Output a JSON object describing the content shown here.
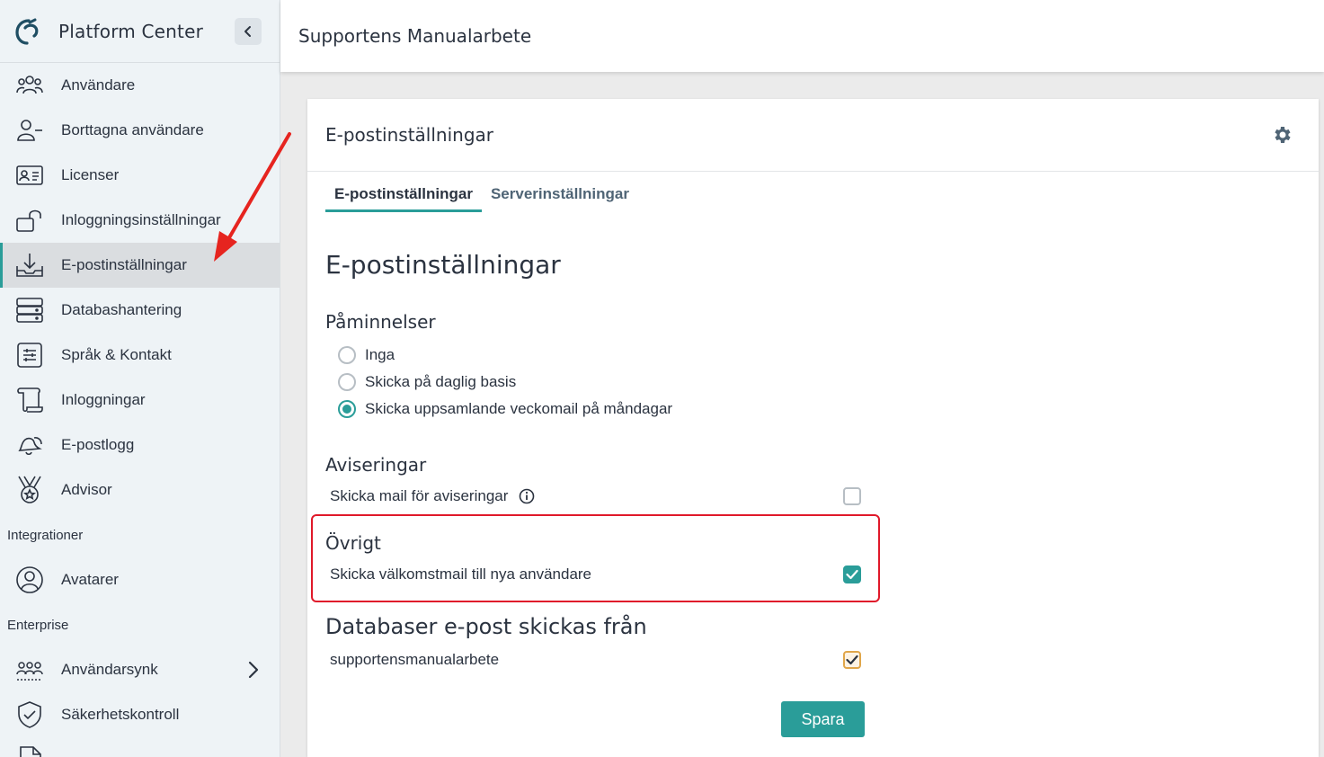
{
  "brand": {
    "name": "Platform Center"
  },
  "sidebar": {
    "items": [
      {
        "label": "Användare",
        "icon": "users-icon"
      },
      {
        "label": "Borttagna användare",
        "icon": "user-remove-icon"
      },
      {
        "label": "Licenser",
        "icon": "id-card-icon"
      },
      {
        "label": "Inloggningsinställningar",
        "icon": "unlock-icon"
      },
      {
        "label": "E-postinställningar",
        "icon": "inbox-download-icon",
        "active": true
      },
      {
        "label": "Databashantering",
        "icon": "server-icon"
      },
      {
        "label": "Språk & Kontakt",
        "icon": "sliders-icon"
      },
      {
        "label": "Inloggningar",
        "icon": "scroll-icon"
      },
      {
        "label": "E-postlogg",
        "icon": "bells-icon"
      },
      {
        "label": "Advisor",
        "icon": "medal-icon"
      }
    ],
    "sections": [
      {
        "title": "Integrationer",
        "items": [
          {
            "label": "Avatarer",
            "icon": "user-circle-icon"
          }
        ]
      },
      {
        "title": "Enterprise",
        "items": [
          {
            "label": "Användarsynk",
            "icon": "users-sync-icon"
          },
          {
            "label": "Säkerhetskontroll",
            "icon": "shield-check-icon"
          }
        ]
      }
    ]
  },
  "header": {
    "title": "Supportens Manualarbete"
  },
  "card": {
    "title": "E-postinställningar",
    "tabs": [
      {
        "label": "E-postinställningar",
        "active": true
      },
      {
        "label": "Serverinställningar"
      }
    ],
    "heading": "E-postinställningar",
    "reminders": {
      "title": "Påminnelser",
      "options": [
        {
          "label": "Inga",
          "checked": false
        },
        {
          "label": "Skicka på daglig basis",
          "checked": false
        },
        {
          "label": "Skicka uppsamlande veckomail på måndagar",
          "checked": true
        }
      ]
    },
    "notifications": {
      "title": "Aviseringar",
      "label": "Skicka mail för aviseringar",
      "checked": false
    },
    "other": {
      "title": "Övrigt",
      "label": "Skicka välkomstmail till nya användare",
      "checked": true
    },
    "databases": {
      "title": "Databaser e-post skickas från",
      "label": "supportensmanualarbete",
      "checked": true
    },
    "save_label": "Spara"
  },
  "colors": {
    "accent": "#2a9d99",
    "highlight": "#e0192a",
    "text": "#2b3340"
  }
}
